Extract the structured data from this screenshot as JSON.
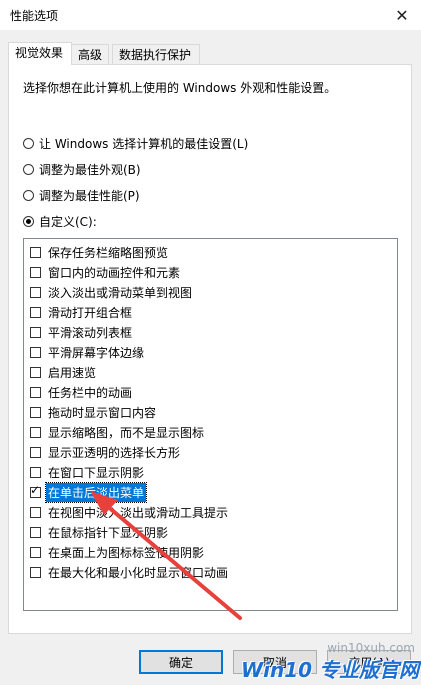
{
  "window": {
    "title": "性能选项"
  },
  "tabs": [
    {
      "label": "视觉效果"
    },
    {
      "label": "高级"
    },
    {
      "label": "数据执行保护"
    }
  ],
  "description": "选择你想在此计算机上使用的 Windows 外观和性能设置。",
  "radios": [
    {
      "label": "让 Windows 选择计算机的最佳设置(L)",
      "checked": false
    },
    {
      "label": "调整为最佳外观(B)",
      "checked": false
    },
    {
      "label": "调整为最佳性能(P)",
      "checked": false
    },
    {
      "label": "自定义(C):",
      "checked": true
    }
  ],
  "options": [
    {
      "label": "保存任务栏缩略图预览",
      "checked": false
    },
    {
      "label": "窗口内的动画控件和元素",
      "checked": false
    },
    {
      "label": "淡入淡出或滑动菜单到视图",
      "checked": false
    },
    {
      "label": "滑动打开组合框",
      "checked": false
    },
    {
      "label": "平滑滚动列表框",
      "checked": false
    },
    {
      "label": "平滑屏幕字体边缘",
      "checked": false
    },
    {
      "label": "启用速览",
      "checked": false
    },
    {
      "label": "任务栏中的动画",
      "checked": false
    },
    {
      "label": "拖动时显示窗口内容",
      "checked": false
    },
    {
      "label": "显示缩略图，而不是显示图标",
      "checked": false
    },
    {
      "label": "显示亚透明的选择长方形",
      "checked": false
    },
    {
      "label": "在窗口下显示阴影",
      "checked": false
    },
    {
      "label": "在单击后淡出菜单",
      "checked": true,
      "selected": true
    },
    {
      "label": "在视图中淡入淡出或滑动工具提示",
      "checked": false
    },
    {
      "label": "在鼠标指针下显示阴影",
      "checked": false
    },
    {
      "label": "在桌面上为图标标签使用阴影",
      "checked": false
    },
    {
      "label": "在最大化和最小化时显示窗口动画",
      "checked": false
    }
  ],
  "buttons": {
    "ok": "确定",
    "cancel": "取消",
    "apply": "应用(A)"
  },
  "watermark": {
    "url": "win10xuh.com",
    "brand": "Win10 专业版官网"
  },
  "colors": {
    "selection": "#0078d7",
    "annotation_arrow": "#e8413c",
    "watermark": "#1e6fd0"
  },
  "icons": {
    "close": "close-icon",
    "annotation": "red-arrow-icon"
  }
}
